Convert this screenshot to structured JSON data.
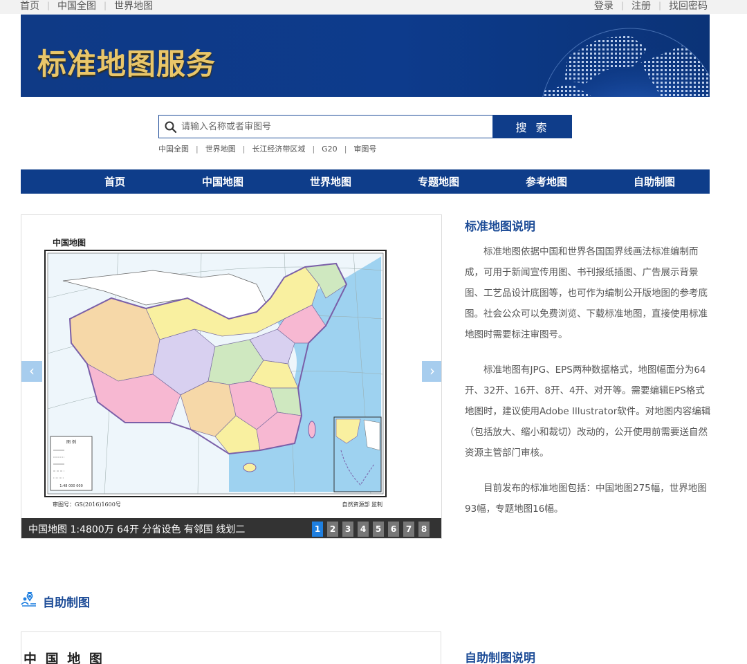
{
  "topbar": {
    "left_links": [
      "首页",
      "中国全图",
      "世界地图"
    ],
    "right_links": [
      "登录",
      "注册",
      "找回密码"
    ]
  },
  "banner": {
    "title": "标准地图服务"
  },
  "search": {
    "placeholder": "请输入名称或者审图号",
    "button_label": "搜 索",
    "quick_links": [
      "中国全图",
      "世界地图",
      "长江经济带区域",
      "G20",
      "审图号"
    ]
  },
  "nav": {
    "items": [
      "首页",
      "中国地图",
      "世界地图",
      "专题地图",
      "参考地图",
      "自助制图"
    ]
  },
  "carousel": {
    "caption": "中国地图 1:4800万 64开 分省设色 有邻国 线划二",
    "pages": [
      "1",
      "2",
      "3",
      "4",
      "5",
      "6",
      "7",
      "8"
    ],
    "active_page": "1",
    "map": {
      "title": "中国地图",
      "approval_no": "审图号：GS(2016)1600号",
      "supervisor": "自然资源部 监制",
      "legend_title": "图 例",
      "scale": "1:48 000 000"
    }
  },
  "description": {
    "title": "标准地图说明",
    "paragraphs": [
      "标准地图依据中国和世界各国国界线画法标准编制而成，可用于新闻宣传用图、书刊报纸插图、广告展示背景图、工艺品设计底图等，也可作为编制公开版地图的参考底图。社会公众可以免费浏览、下载标准地图，直接使用标准地图时需要标注审图号。",
      "标准地图有JPG、EPS两种数据格式，地图幅面分为64开、32开、16开、8开、4开、对开等。需要编辑EPS格式地图时，建议使用Adobe Illustrator软件。对地图内容编辑（包括放大、缩小和裁切）改动的，公开使用前需要送自然资源主管部门审核。",
      "目前发布的标准地图包括：中国地图275幅，世界地图93幅，专题地图16幅。"
    ]
  },
  "self_mapping": {
    "heading": "自助制图",
    "card_title": "中 国 地 图",
    "desc_title": "自助制图说明"
  },
  "colors": {
    "brand_blue": "#0e3d8a",
    "title_blue": "#1d4c97",
    "banner_gold": "#e9c66a",
    "pager_active": "#1e7fe0"
  }
}
